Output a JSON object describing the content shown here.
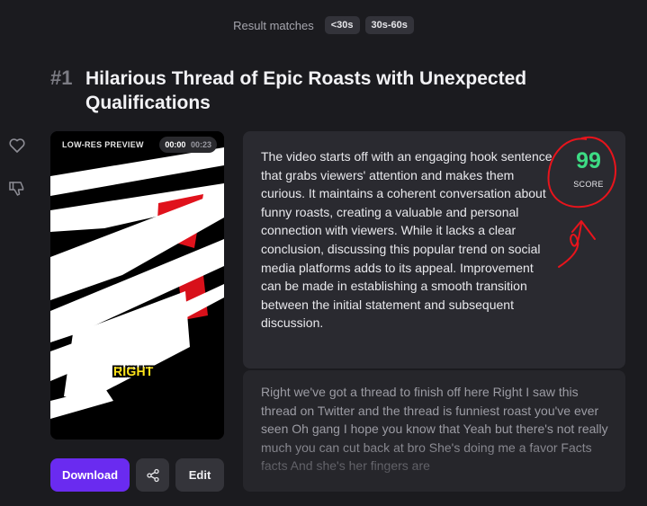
{
  "filter": {
    "label": "Result matches",
    "chips": [
      "<30s",
      "30s-60s"
    ]
  },
  "result": {
    "rank": "#1",
    "title": "Hilarious Thread of Epic Roasts with Unexpected Qualifications"
  },
  "side_actions": {
    "like_icon": "heart-icon",
    "dislike_icon": "thumbs-down-icon"
  },
  "video": {
    "preview_label": "LOW-RES PREVIEW",
    "current_time": "00:00",
    "duration": "00:23",
    "caption": "RIGHT"
  },
  "actions": {
    "download_label": "Download",
    "share_icon": "share-icon",
    "edit_label": "Edit"
  },
  "analysis": {
    "description": "The video starts off with an engaging hook sentence that grabs viewers' attention and makes them curious. It maintains a coherent conversation about funny roasts, creating a valuable and personal connection with viewers. While it lacks a clear conclusion, discussing this popular trend on social media platforms adds to its appeal. Improvement can be made in establishing a smooth transition between the initial statement and subsequent discussion.",
    "score": "99",
    "score_label": "SCORE"
  },
  "transcript": {
    "text": "Right we've got a thread to finish off here Right I saw this thread on Twitter and the thread is funniest roast you've ever seen Oh gang I hope you know that Yeah but there's not really much you can cut back at bro She's doing me a favor Facts facts And she's her fingers are"
  },
  "colors": {
    "background": "#1b1b1f",
    "accent": "#6a2bf0",
    "score": "#3ddc84",
    "annotation": "#e8141c",
    "caption": "#ffe41a"
  }
}
